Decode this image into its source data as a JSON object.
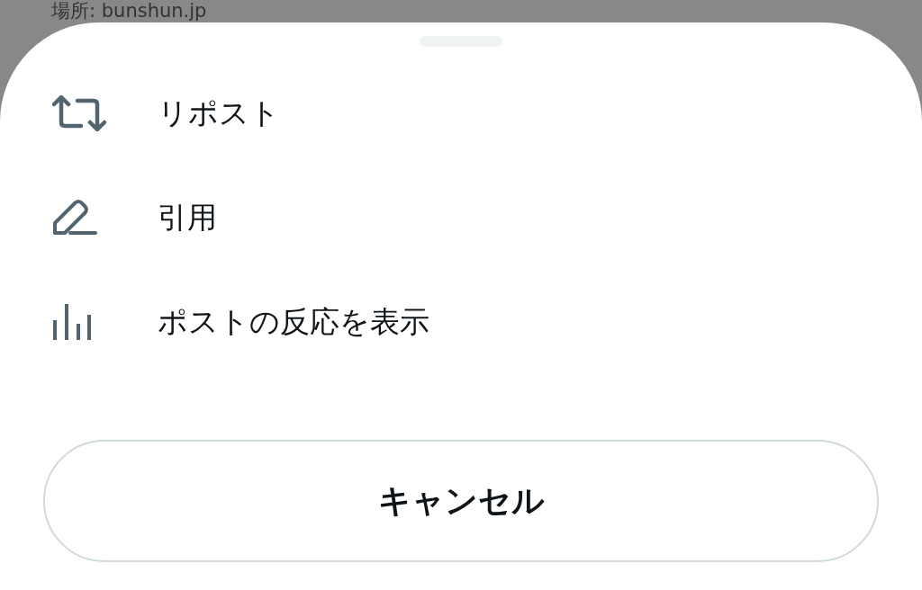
{
  "background": {
    "text": "場所: bunshun.jp"
  },
  "sheet": {
    "items": [
      {
        "kind": "repost",
        "label": "リポスト"
      },
      {
        "kind": "quote",
        "label": "引用"
      },
      {
        "kind": "engagements",
        "label": "ポストの反応を表示"
      }
    ],
    "cancel_button": "キャンセル"
  }
}
